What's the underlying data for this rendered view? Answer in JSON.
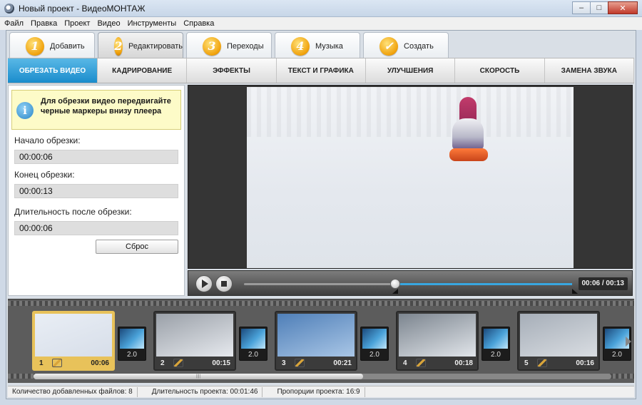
{
  "window": {
    "title": "Новый проект - ВидеоМОНТАЖ",
    "controls": [
      "–",
      "□",
      "✕"
    ]
  },
  "menu": [
    "Файл",
    "Правка",
    "Проект",
    "Видео",
    "Инструменты",
    "Справка"
  ],
  "steps": [
    {
      "num": "1",
      "label": "Добавить"
    },
    {
      "num": "2",
      "label": "Редактировать"
    },
    {
      "num": "3",
      "label": "Переходы"
    },
    {
      "num": "4",
      "label": "Музыка"
    },
    {
      "num": "✓",
      "label": "Создать"
    }
  ],
  "tabs": [
    "ОБРЕЗАТЬ ВИДЕО",
    "КАДРИРОВАНИЕ",
    "ЭФФЕКТЫ",
    "ТЕКСТ И ГРАФИКА",
    "УЛУЧШЕНИЯ",
    "СКОРОСТЬ",
    "ЗАМЕНА ЗВУКА"
  ],
  "trim": {
    "info_icon": "i",
    "info": "Для обрезки видео передвигайте черные маркеры внизу плеера",
    "start_label": "Начало обрезки:",
    "start_value": "00:00:06",
    "end_label": "Конец обрезки:",
    "end_value": "00:00:13",
    "duration_label": "Длительность после обрезки:",
    "duration_value": "00:00:06",
    "reset_label": "Сброс"
  },
  "player": {
    "timecode": "00:06 / 00:13",
    "progress_fraction": 0.46
  },
  "timeline": {
    "clips": [
      {
        "num": "1",
        "duration": "00:06",
        "colors": [
          "#e9eef5",
          "#d7dee9"
        ]
      },
      {
        "num": "2",
        "duration": "00:15",
        "colors": [
          "#9aa0a8",
          "#e6e9ee"
        ]
      },
      {
        "num": "3",
        "duration": "00:21",
        "colors": [
          "#4f7fb8",
          "#a9c6e6"
        ]
      },
      {
        "num": "4",
        "duration": "00:18",
        "colors": [
          "#7c858f",
          "#e1e5ea"
        ]
      },
      {
        "num": "5",
        "duration": "00:16",
        "colors": [
          "#a6aeb8",
          "#d9dde2"
        ]
      }
    ],
    "transitions": [
      "2.0",
      "2.0",
      "2.0",
      "2.0",
      "2.0"
    ],
    "scroll_grip": "||||"
  },
  "status": {
    "files": "Количество добавленных файлов: 8",
    "duration": "Длительность проекта:  00:01:46",
    "aspect": "Пропорции проекта:  16:9"
  },
  "colors": {
    "accent": "#1a8ccc",
    "step_badge": "#f0a10b",
    "clip_selected": "#e8c25a"
  }
}
